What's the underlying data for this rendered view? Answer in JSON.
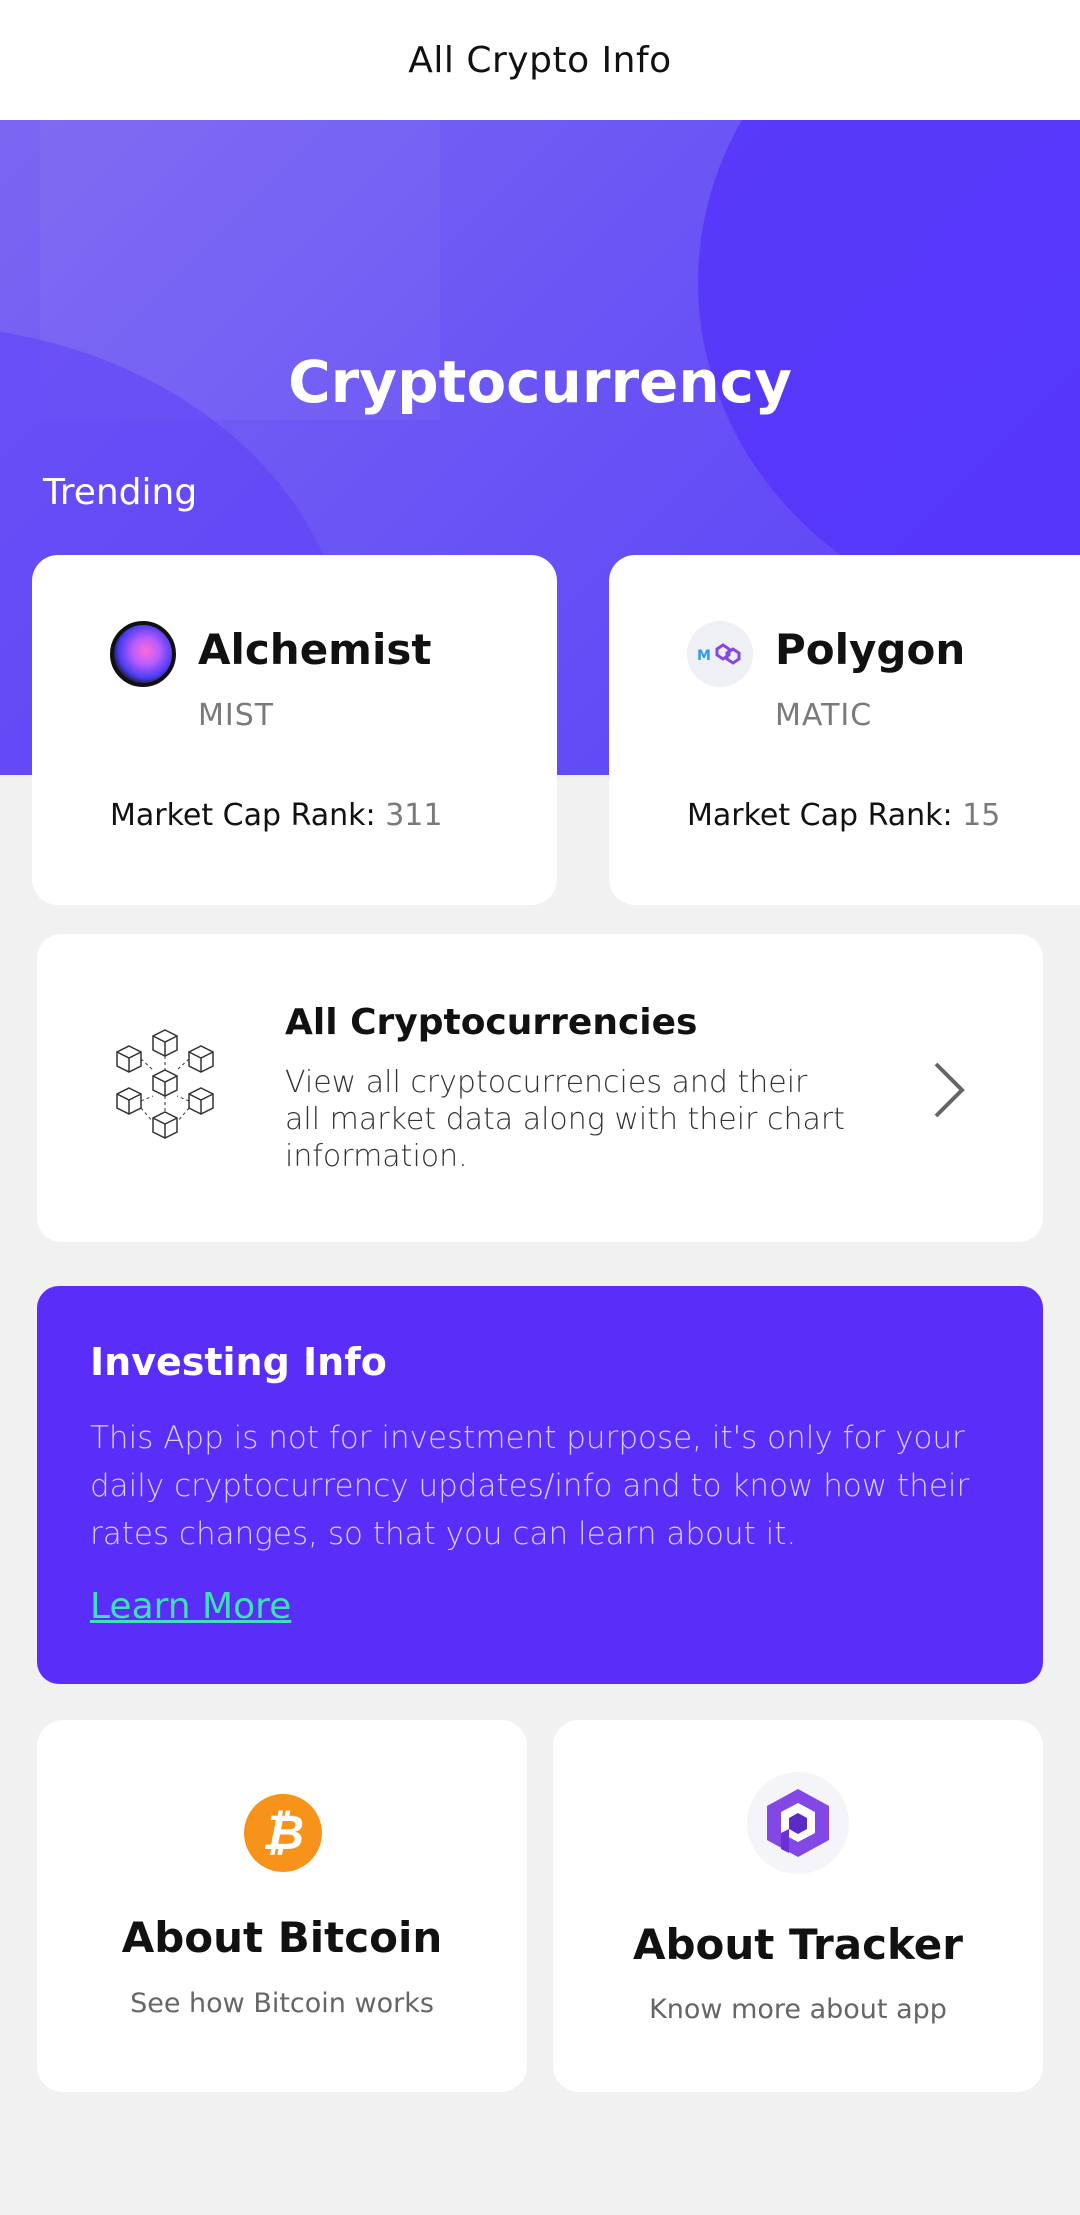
{
  "app_bar": {
    "title": "All Crypto Info"
  },
  "hero": {
    "title": "Cryptocurrency",
    "trending_label": "Trending"
  },
  "trending": [
    {
      "name": "Alchemist",
      "symbol": "MIST",
      "rank_label": "Market Cap Rank:",
      "rank_value": "311",
      "icon": "alchemist-logo-icon"
    },
    {
      "name": "Polygon",
      "symbol": "MATIC",
      "rank_label": "Market Cap Rank:",
      "rank_value": "15",
      "icon": "polygon-logo-icon"
    }
  ],
  "all_crypto": {
    "title": "All Cryptocurrencies",
    "description": "View all cryptocurrencies and their all market data along with their chart information.",
    "icon": "blockchain-cubes-icon"
  },
  "investing": {
    "title": "Investing Info",
    "description": "This App is not for investment purpose, it's only for your daily cryptocurrency updates/info and to know how their rates changes, so that you can learn about it.",
    "link_label": "Learn More"
  },
  "info_cards": [
    {
      "title": "About Bitcoin",
      "subtitle": "See how Bitcoin works",
      "icon": "bitcoin-icon"
    },
    {
      "title": "About Tracker",
      "subtitle": "Know more about app",
      "icon": "tracker-logo-icon"
    }
  ],
  "colors": {
    "hero_gradient_start": "#7b66f2",
    "hero_gradient_end": "#5a3ff8",
    "invest_bg": "#5a2ef8",
    "link": "#3fe0b8",
    "bitcoin": "#f7931a"
  }
}
